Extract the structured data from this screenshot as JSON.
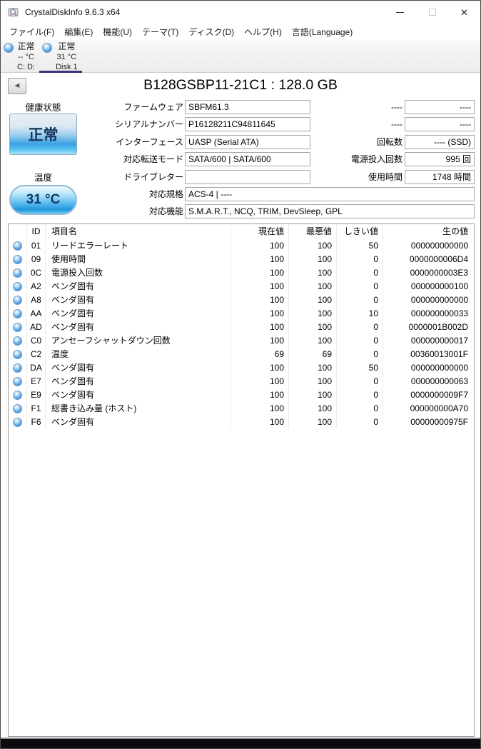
{
  "window": {
    "title": "CrystalDiskInfo 9.6.3 x64",
    "controls": {
      "minimize": "",
      "maximize": "",
      "close": "✕"
    }
  },
  "menu": {
    "items": [
      {
        "label": "ファイル(F)"
      },
      {
        "label": "編集(E)"
      },
      {
        "label": "機能(U)"
      },
      {
        "label": "テーマ(T)"
      },
      {
        "label": "ディスク(D)"
      },
      {
        "label": "ヘルプ(H)"
      },
      {
        "label": "言語(Language)"
      }
    ]
  },
  "disk_tabs": [
    {
      "status": "正常",
      "temp": "-- °C",
      "name": "C: D:"
    },
    {
      "status": "正常",
      "temp": "31 °C",
      "name": "Disk 1"
    }
  ],
  "drive": {
    "title": "B128GSBP11-21C1 : 128.0 GB",
    "health": {
      "label": "健康状態",
      "value": "正常"
    },
    "temperature": {
      "label": "温度",
      "value": "31 °C"
    },
    "firmware": {
      "label": "ファームウェア",
      "value": "SBFM61.3"
    },
    "serial": {
      "label": "シリアルナンバー",
      "value": "P16128211C94811645"
    },
    "interface": {
      "label": "インターフェース",
      "value": "UASP (Serial ATA)"
    },
    "transfer_mode": {
      "label": "対応転送モード",
      "value": "SATA/600 | SATA/600"
    },
    "drive_letter": {
      "label": "ドライブレター",
      "value": ""
    },
    "standard": {
      "label": "対応規格",
      "value": "ACS-4 | ----"
    },
    "features": {
      "label": "対応機能",
      "value": "S.M.A.R.T., NCQ, TRIM, DevSleep, GPL"
    },
    "dash_row_1": {
      "label": "----",
      "value": "----"
    },
    "dash_row_2": {
      "label": "----",
      "value": "----"
    },
    "rotation": {
      "label": "回転数",
      "value": "---- (SSD)"
    },
    "power_on_count": {
      "label": "電源投入回数",
      "value": "995 回"
    },
    "power_on_hours": {
      "label": "使用時間",
      "value": "1748 時間"
    }
  },
  "smart_table": {
    "headers": {
      "id": "ID",
      "name": "項目名",
      "current": "現在値",
      "worst": "最悪値",
      "threshold": "しきい値",
      "raw": "生の値"
    },
    "rows": [
      {
        "id": "01",
        "name": "リードエラーレート",
        "current": "100",
        "worst": "100",
        "threshold": "50",
        "raw": "000000000000"
      },
      {
        "id": "09",
        "name": "使用時間",
        "current": "100",
        "worst": "100",
        "threshold": "0",
        "raw": "0000000006D4"
      },
      {
        "id": "0C",
        "name": "電源投入回数",
        "current": "100",
        "worst": "100",
        "threshold": "0",
        "raw": "0000000003E3"
      },
      {
        "id": "A2",
        "name": "ベンダ固有",
        "current": "100",
        "worst": "100",
        "threshold": "0",
        "raw": "000000000100"
      },
      {
        "id": "A8",
        "name": "ベンダ固有",
        "current": "100",
        "worst": "100",
        "threshold": "0",
        "raw": "000000000000"
      },
      {
        "id": "AA",
        "name": "ベンダ固有",
        "current": "100",
        "worst": "100",
        "threshold": "10",
        "raw": "000000000033"
      },
      {
        "id": "AD",
        "name": "ベンダ固有",
        "current": "100",
        "worst": "100",
        "threshold": "0",
        "raw": "0000001B002D"
      },
      {
        "id": "C0",
        "name": "アンセーフシャットダウン回数",
        "current": "100",
        "worst": "100",
        "threshold": "0",
        "raw": "000000000017"
      },
      {
        "id": "C2",
        "name": "温度",
        "current": "69",
        "worst": "69",
        "threshold": "0",
        "raw": "00360013001F"
      },
      {
        "id": "DA",
        "name": "ベンダ固有",
        "current": "100",
        "worst": "100",
        "threshold": "50",
        "raw": "000000000000"
      },
      {
        "id": "E7",
        "name": "ベンダ固有",
        "current": "100",
        "worst": "100",
        "threshold": "0",
        "raw": "000000000063"
      },
      {
        "id": "E9",
        "name": "ベンダ固有",
        "current": "100",
        "worst": "100",
        "threshold": "0",
        "raw": "0000000009F7"
      },
      {
        "id": "F1",
        "name": "総書き込み量 (ホスト)",
        "current": "100",
        "worst": "100",
        "threshold": "0",
        "raw": "000000000A70"
      },
      {
        "id": "F6",
        "name": "ベンダ固有",
        "current": "100",
        "worst": "100",
        "threshold": "0",
        "raw": "00000000975F"
      }
    ]
  }
}
